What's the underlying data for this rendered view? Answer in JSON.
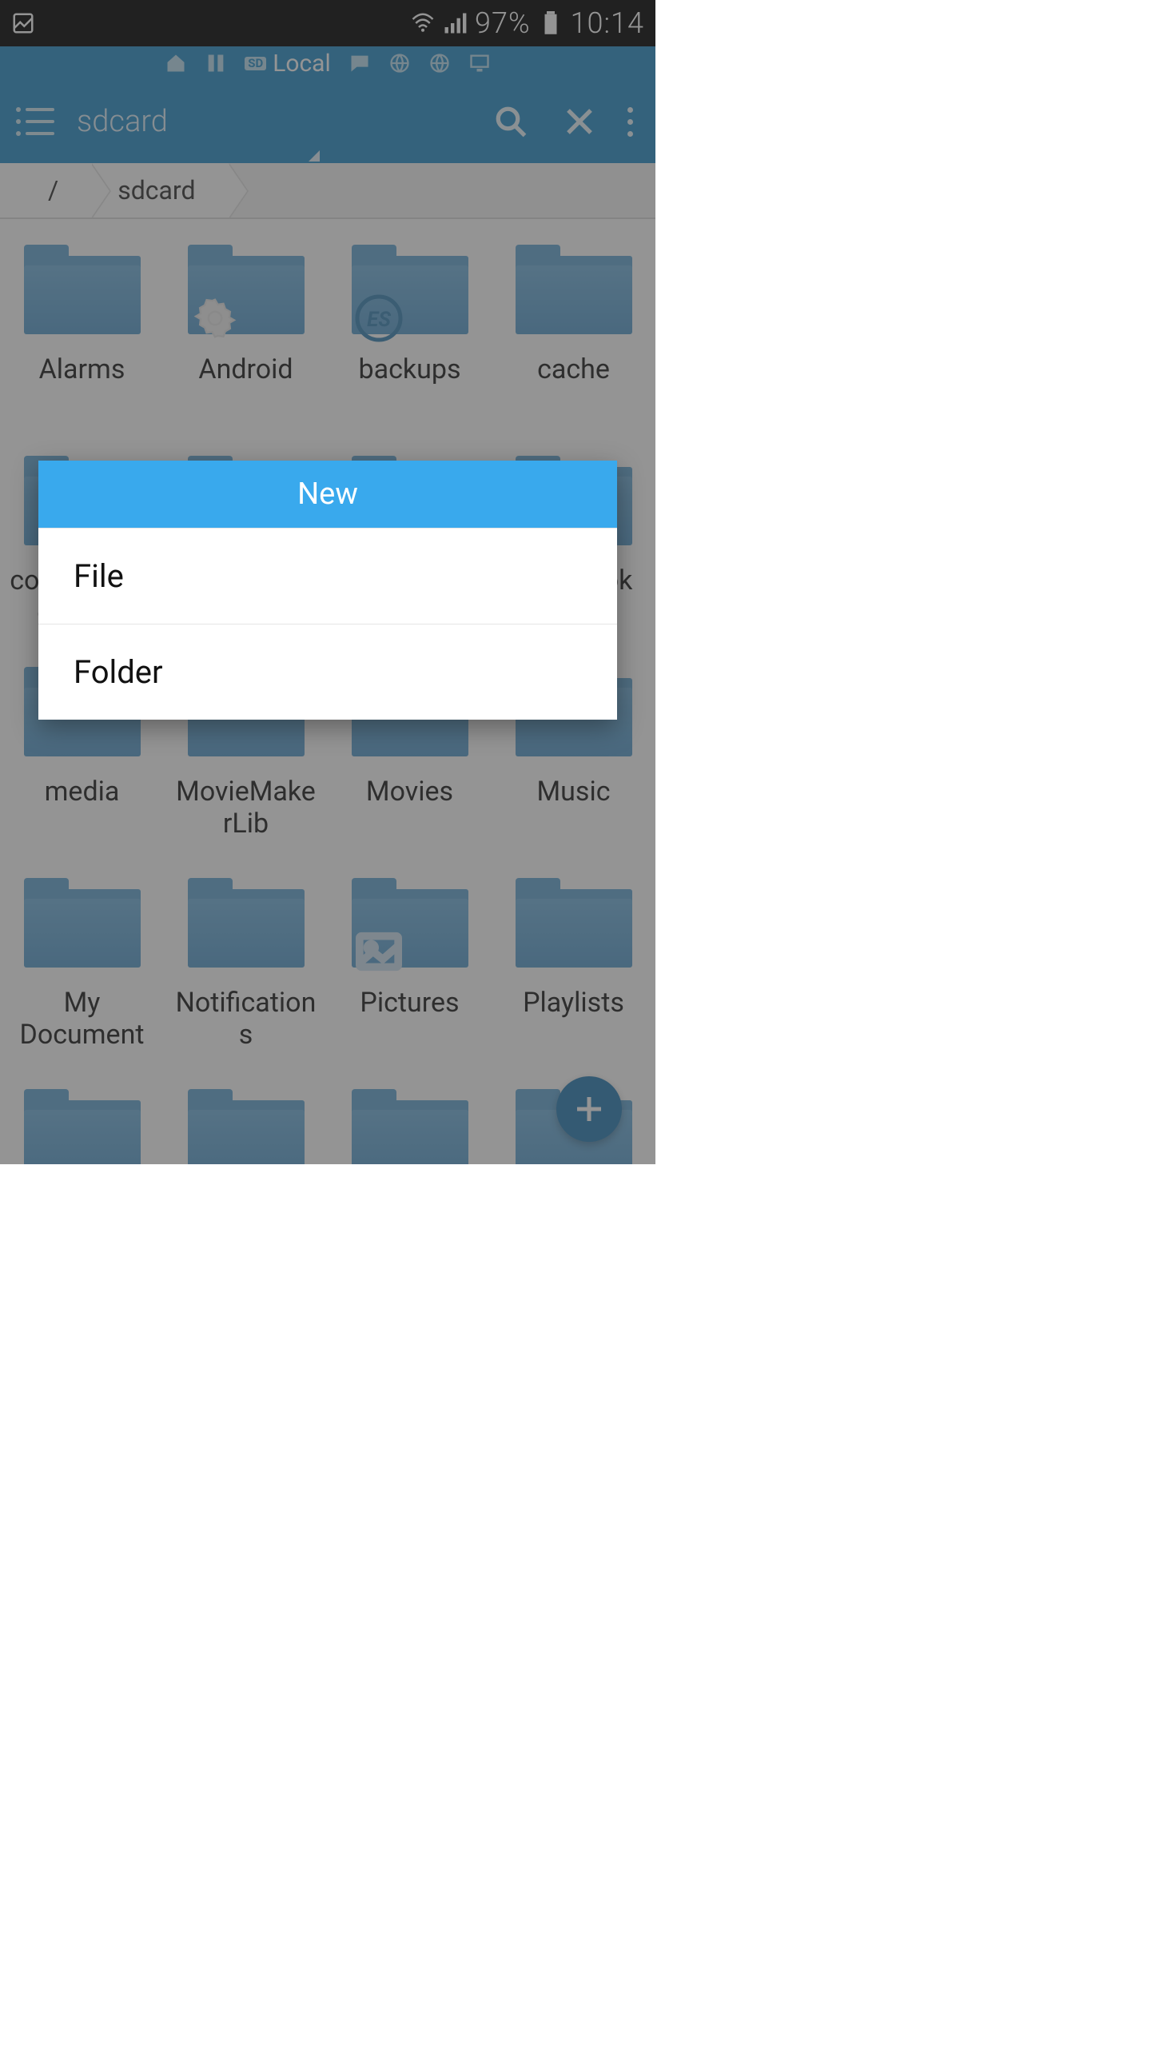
{
  "status": {
    "battery": "97%",
    "clock": "10:14"
  },
  "tabstrip": {
    "active_label": "Local"
  },
  "actionbar": {
    "title": "sdcard"
  },
  "breadcrumb": [
    "/",
    "sdcard"
  ],
  "folders": [
    {
      "name": "Alarms",
      "overlay": null
    },
    {
      "name": "Android",
      "overlay": "gear"
    },
    {
      "name": "backups",
      "overlay": "es"
    },
    {
      "name": "cache",
      "overlay": null
    },
    {
      "name": "com.facebook.orca",
      "overlay": null
    },
    {
      "name": "",
      "overlay": null
    },
    {
      "name": "",
      "overlay": null
    },
    {
      "name": "Facebook Image",
      "overlay": null
    },
    {
      "name": "media",
      "overlay": null
    },
    {
      "name": "MovieMakerLib",
      "overlay": null
    },
    {
      "name": "Movies",
      "overlay": null
    },
    {
      "name": "Music",
      "overlay": null
    },
    {
      "name": "My Document",
      "overlay": null
    },
    {
      "name": "Notifications",
      "overlay": null
    },
    {
      "name": "Pictures",
      "overlay": "pic"
    },
    {
      "name": "Playlists",
      "overlay": null
    },
    {
      "name": "",
      "overlay": null
    },
    {
      "name": "",
      "overlay": null
    },
    {
      "name": "",
      "overlay": null
    },
    {
      "name": "",
      "overlay": null
    }
  ],
  "dialog": {
    "title": "New",
    "options": [
      "File",
      "Folder"
    ]
  }
}
